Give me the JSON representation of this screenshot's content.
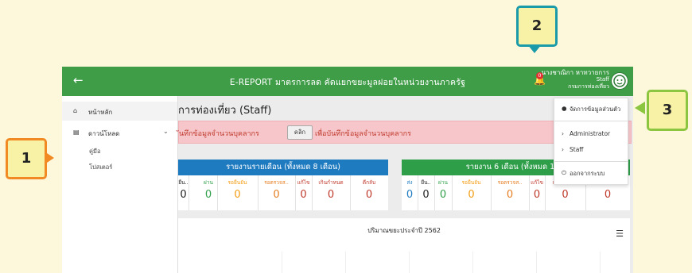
{
  "topbar": {
    "back_icon": "arrow-left-icon",
    "title": "E-REPORT มาตรการลด คัดแยกขยะมูลฝอยในหน่วยงานภาครัฐ",
    "notification_count": "0",
    "user_name": "นางชาณิกา หาทวายการ",
    "user_role": "Staff",
    "user_org": "กรมการท่องเที่ยว"
  },
  "sidebar": {
    "home_label": "หน้าหลัก",
    "download_label": "ดาวน์โหลด",
    "sub_items": [
      "คู่มือ",
      "โปสเตอร์"
    ]
  },
  "main": {
    "page_title": "การท่องเที่ยว (Staff)",
    "alert_text1": "ันทึกข้อมูลจำนวนบุคลากร",
    "alert_button": "คลิก",
    "alert_text2": "เพื่อบันทึกข้อมูลจำนวนบุคลากร"
  },
  "monthly_card": {
    "title": "รายงานรายเดือน (ทั้งหมด 8 เดือน)",
    "columns": [
      {
        "label": "ยืน..",
        "value": "0",
        "color": "#222222"
      },
      {
        "label": "ผ่าน",
        "value": "0",
        "color": "#2e9e49"
      },
      {
        "label": "รอยืนยัน",
        "value": "0",
        "color": "#f39c12"
      },
      {
        "label": "รอตรวจส..",
        "value": "0",
        "color": "#e67e22"
      },
      {
        "label": "แก้ไข",
        "value": "0",
        "color": "#c0392b"
      },
      {
        "label": "เกินกำหนด",
        "value": "0",
        "color": "#c0392b"
      },
      {
        "label": "ตีกลับ",
        "value": "0",
        "color": "#c0392b"
      }
    ]
  },
  "six_month_card": {
    "title": "รายงาน 6 เดือน (ทั้งหมด 10 ร",
    "columns": [
      {
        "label": "ส่ง",
        "value": "0",
        "color": "#1f7bc0"
      },
      {
        "label": "ยืน..",
        "value": "0",
        "color": "#222222"
      },
      {
        "label": "ผ่าน",
        "value": "0",
        "color": "#2e9e49"
      },
      {
        "label": "รอยืนยัน",
        "value": "0",
        "color": "#f39c12"
      },
      {
        "label": "รอตรวจส..",
        "value": "0",
        "color": "#e67e22"
      },
      {
        "label": "แก้ไข",
        "value": "0",
        "color": "#c0392b"
      },
      {
        "label": "เกินกำหนด",
        "value": "0",
        "color": "#c0392b"
      },
      {
        "label": "ตีกลับ",
        "value": "0",
        "color": "#c0392b"
      }
    ]
  },
  "chart": {
    "title": "ปริมาณขยะประจำปี 2562",
    "menu_icon": "hamburger-icon"
  },
  "user_menu": {
    "profile_label": "จัดการข้อมูลส่วนตัว",
    "admin_label": "Administrator",
    "staff_label": "Staff",
    "logout_label": "ออกจากระบบ"
  },
  "callouts": [
    "1",
    "2",
    "3"
  ]
}
